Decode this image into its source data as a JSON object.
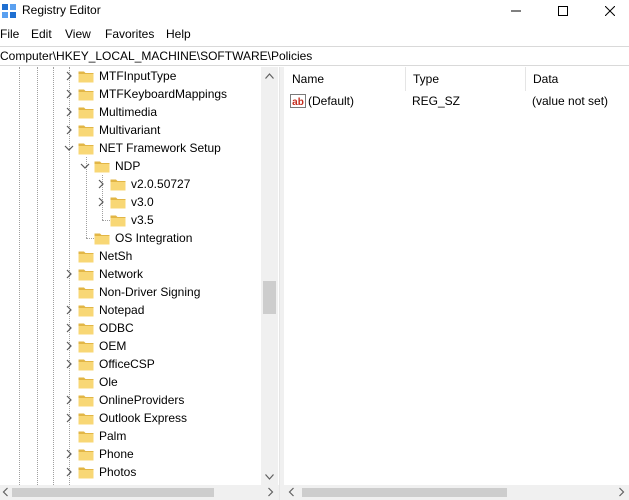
{
  "window": {
    "title": "Registry Editor"
  },
  "menu": [
    "File",
    "Edit",
    "View",
    "Favorites",
    "Help"
  ],
  "address": "Computer\\HKEY_LOCAL_MACHINE\\SOFTWARE\\Policies",
  "tree": {
    "items": [
      {
        "label": "MTFInputType",
        "chevron": "right"
      },
      {
        "label": "MTFKeyboardMappings",
        "chevron": "right"
      },
      {
        "label": "Multimedia",
        "chevron": "right"
      },
      {
        "label": "Multivariant",
        "chevron": "right"
      },
      {
        "label": "NET Framework Setup",
        "chevron": "down"
      },
      {
        "label": "NDP",
        "chevron": "down"
      },
      {
        "label": "v2.0.50727",
        "chevron": "right"
      },
      {
        "label": "v3.0",
        "chevron": "right"
      },
      {
        "label": "v3.5",
        "chevron": ""
      },
      {
        "label": "OS Integration",
        "chevron": ""
      },
      {
        "label": "NetSh",
        "chevron": ""
      },
      {
        "label": "Network",
        "chevron": "right"
      },
      {
        "label": "Non-Driver Signing",
        "chevron": ""
      },
      {
        "label": "Notepad",
        "chevron": "right"
      },
      {
        "label": "ODBC",
        "chevron": "right"
      },
      {
        "label": "OEM",
        "chevron": "right"
      },
      {
        "label": "OfficeCSP",
        "chevron": "right"
      },
      {
        "label": "Ole",
        "chevron": ""
      },
      {
        "label": "OnlineProviders",
        "chevron": "right"
      },
      {
        "label": "Outlook Express",
        "chevron": "right"
      },
      {
        "label": "Palm",
        "chevron": ""
      },
      {
        "label": "Phone",
        "chevron": "right"
      },
      {
        "label": "Photos",
        "chevron": "right"
      }
    ]
  },
  "list": {
    "columns": [
      "Name",
      "Type",
      "Data"
    ],
    "rows": [
      {
        "icon": "string-value-icon",
        "name": "(Default)",
        "type": "REG_SZ",
        "data": "(value not set)"
      }
    ]
  },
  "colors": {
    "folder": "#f8d775",
    "folder_dark": "#e2b646",
    "ab_red": "#c42b1c"
  }
}
